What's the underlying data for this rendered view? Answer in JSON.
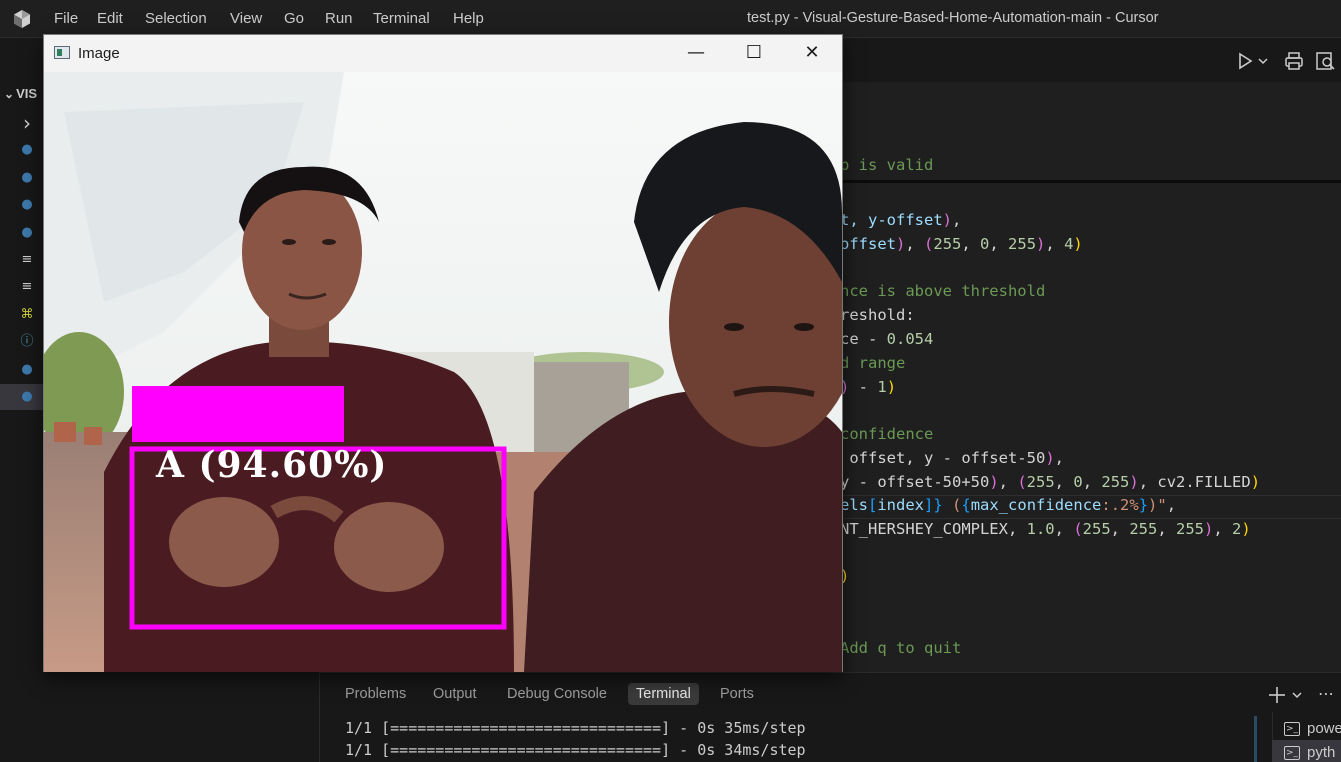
{
  "titlebar": {
    "menus": [
      "File",
      "Edit",
      "Selection",
      "View",
      "Go",
      "Run",
      "Terminal",
      "Help"
    ],
    "window_title": "test.py - Visual-Gesture-Based-Home-Automation-main - Cursor"
  },
  "explorer": {
    "header": "VIS",
    "file_icons": [
      "chevron-right-icon",
      "python-file-icon",
      "python-file-icon",
      "python-file-icon",
      "python-file-icon",
      "text-file-icon",
      "text-file-icon",
      "license-icon",
      "info-icon",
      "python-file-icon",
      "python-file-icon"
    ]
  },
  "editor": {
    "code_lines": [
      {
        "segments": [
          {
            "t": "p is valid",
            "c": "c-comment"
          }
        ]
      },
      {
        "segments": [
          {
            "t": "t, y-offset",
            "c": "c-var"
          },
          {
            "t": ")",
            "c": "c-p2"
          },
          {
            "t": ",",
            "c": ""
          }
        ]
      },
      {
        "segments": [
          {
            "t": "offset",
            "c": "c-var"
          },
          {
            "t": ")",
            "c": "c-p2"
          },
          {
            "t": ", ",
            "c": ""
          },
          {
            "t": "(",
            "c": "c-p2"
          },
          {
            "t": "255",
            "c": "c-num"
          },
          {
            "t": ", ",
            "c": ""
          },
          {
            "t": "0",
            "c": "c-num"
          },
          {
            "t": ", ",
            "c": ""
          },
          {
            "t": "255",
            "c": "c-num"
          },
          {
            "t": ")",
            "c": "c-p2"
          },
          {
            "t": ", ",
            "c": ""
          },
          {
            "t": "4",
            "c": "c-num"
          },
          {
            "t": ")",
            "c": "c-p1"
          }
        ]
      },
      {
        "segments": [
          {
            "t": "nce is above threshold",
            "c": "c-comment"
          }
        ]
      },
      {
        "segments": [
          {
            "t": "reshold:",
            "c": ""
          }
        ]
      },
      {
        "segments": [
          {
            "t": "ce - ",
            "c": ""
          },
          {
            "t": "0.054",
            "c": "c-num"
          }
        ]
      },
      {
        "segments": [
          {
            "t": "d range",
            "c": "c-comment"
          }
        ]
      },
      {
        "segments": [
          {
            "t": ")",
            "c": "c-p2"
          },
          {
            "t": " - ",
            "c": ""
          },
          {
            "t": "1",
            "c": "c-num"
          },
          {
            "t": ")",
            "c": "c-p1"
          }
        ]
      },
      {
        "segments": [
          {
            "t": "confidence",
            "c": "c-comment"
          }
        ]
      },
      {
        "segments": [
          {
            "t": " offset, y - offset-50",
            "c": ""
          },
          {
            "t": ")",
            "c": "c-p2"
          },
          {
            "t": ",",
            "c": ""
          }
        ]
      },
      {
        "segments": [
          {
            "t": "y - offset-50+50",
            "c": ""
          },
          {
            "t": ")",
            "c": "c-p2"
          },
          {
            "t": ", ",
            "c": ""
          },
          {
            "t": "(",
            "c": "c-p2"
          },
          {
            "t": "255",
            "c": "c-num"
          },
          {
            "t": ", ",
            "c": ""
          },
          {
            "t": "0",
            "c": "c-num"
          },
          {
            "t": ", ",
            "c": ""
          },
          {
            "t": "255",
            "c": "c-num"
          },
          {
            "t": ")",
            "c": "c-p2"
          },
          {
            "t": ", cv2.FILLED",
            "c": ""
          },
          {
            "t": ")",
            "c": "c-p1"
          }
        ]
      },
      {
        "segments": [
          {
            "t": "els",
            "c": "c-var"
          },
          {
            "t": "[",
            "c": "c-p3"
          },
          {
            "t": "index",
            "c": "c-var"
          },
          {
            "t": "]",
            "c": "c-p3"
          },
          {
            "t": "} ",
            "c": "c-p3"
          },
          {
            "t": "(",
            "c": "c-str"
          },
          {
            "t": "{",
            "c": "c-p3"
          },
          {
            "t": "max_confidence",
            "c": "c-var"
          },
          {
            "t": ":.2%",
            "c": "c-str"
          },
          {
            "t": "}",
            "c": "c-p3"
          },
          {
            "t": ")\"",
            "c": "c-str"
          },
          {
            "t": ",",
            "c": ""
          }
        ]
      },
      {
        "segments": [
          {
            "t": "NT_HERSHEY_COMPLEX, ",
            "c": ""
          },
          {
            "t": "1.0",
            "c": "c-num"
          },
          {
            "t": ", ",
            "c": ""
          },
          {
            "t": "(",
            "c": "c-p2"
          },
          {
            "t": "255",
            "c": "c-num"
          },
          {
            "t": ", ",
            "c": ""
          },
          {
            "t": "255",
            "c": "c-num"
          },
          {
            "t": ", ",
            "c": ""
          },
          {
            "t": "255",
            "c": "c-num"
          },
          {
            "t": ")",
            "c": "c-p2"
          },
          {
            "t": ", ",
            "c": ""
          },
          {
            "t": "2",
            "c": "c-num"
          },
          {
            "t": ")",
            "c": "c-p1"
          }
        ]
      },
      {
        "segments": [
          {
            "t": ")",
            "c": "c-p1"
          }
        ]
      },
      {
        "segments": [
          {
            "t": "Add q to quit",
            "c": "c-comment"
          }
        ]
      }
    ]
  },
  "panel": {
    "tabs": [
      "Problems",
      "Output",
      "Debug Console",
      "Terminal",
      "Ports"
    ],
    "active_tab": "Terminal",
    "terminal_lines": [
      "1/1 [==============================] - 0s 35ms/step",
      "1/1 [==============================] - 0s 34ms/step"
    ],
    "terminal_list": [
      "powe",
      "pyth"
    ]
  },
  "image_window": {
    "title": "Image",
    "minimize_glyph": "—",
    "maximize_glyph": "☐",
    "close_glyph": "✕",
    "prediction_label": "A (94.60%)",
    "box_color": "#ff00ff"
  }
}
